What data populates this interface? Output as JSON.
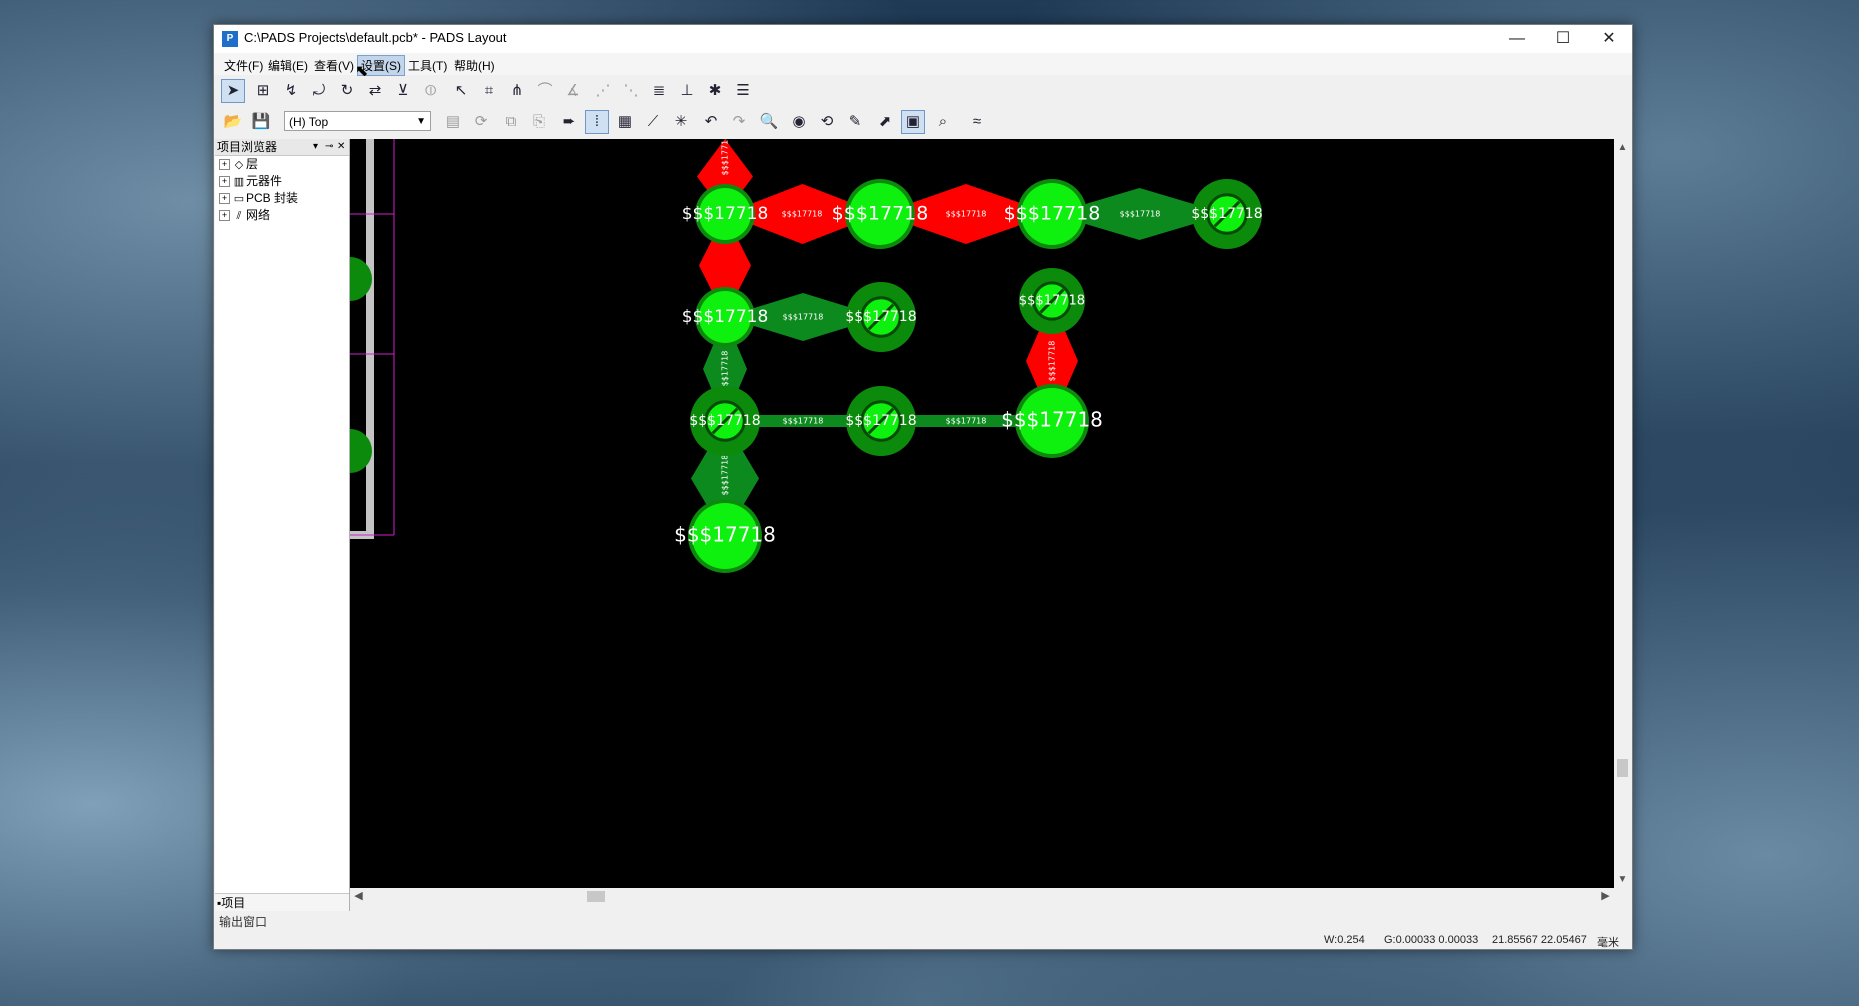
{
  "window": {
    "title": "C:\\PADS Projects\\default.pcb* - PADS Layout"
  },
  "window_controls": {
    "minimize": "—",
    "maximize": "☐",
    "close": "✕"
  },
  "menu": [
    "文件(F)",
    "编辑(E)",
    "查看(V)",
    "设置(S)",
    "工具(T)",
    "帮助(H)"
  ],
  "active_menu": "设置(S)",
  "layer_select": {
    "value": "(H) Top"
  },
  "project_browser": {
    "title": "项目浏览器",
    "items": [
      {
        "expander": "+",
        "icon": "layers-icon",
        "label": "层"
      },
      {
        "expander": "+",
        "icon": "components-icon",
        "label": "元器件"
      },
      {
        "expander": "+",
        "icon": "pcb-footprint-icon",
        "label": "PCB 封装"
      },
      {
        "expander": "+",
        "icon": "nets-icon",
        "label": "网络"
      }
    ],
    "footer_tab": "项目"
  },
  "output_window": {
    "label": "输出窗口"
  },
  "status": {
    "width": "W:0.254",
    "grid": "G:0.00033 0.00033",
    "coords": "21.85567 22.05467",
    "unit": "毫米"
  },
  "canvas": {
    "pad_label": "$$$17718",
    "trace_label": "$$$17718",
    "colors": {
      "pad_bright": "#0ef00e",
      "pad_dark": "#0c8a0c",
      "trace_green": "#0d8a1e",
      "trace_red": "#ff0000",
      "outline": "#c0c0c0",
      "background": "#000000"
    }
  },
  "icons": {
    "toolbar1": [
      "select-arrow-icon",
      "move-icon",
      "route-icon",
      "rotate-icon",
      "spin-icon",
      "flip-icon",
      "add-via-icon",
      "stretch-icon",
      "split-icon",
      "auto-route-icon",
      "glue-icon",
      "corner-icon",
      "miter-icon",
      "radial-icon",
      "cluster-icon",
      "dim-icon",
      "drc-icon",
      "list-icon"
    ],
    "toolbar2": [
      "open-icon",
      "save-icon",
      "properties-icon",
      "refresh-icon",
      "ecopy-icon",
      "paste-icon",
      "arrow-icon",
      "pour-icon",
      "flood-icon",
      "line-icon",
      "sketch-icon",
      "undo-icon",
      "redo-icon",
      "zoom-icon",
      "view-icon",
      "rotate-view-icon",
      "highlight-icon",
      "report-icon",
      "window-icon",
      "search-icon",
      "signal-icon"
    ]
  }
}
